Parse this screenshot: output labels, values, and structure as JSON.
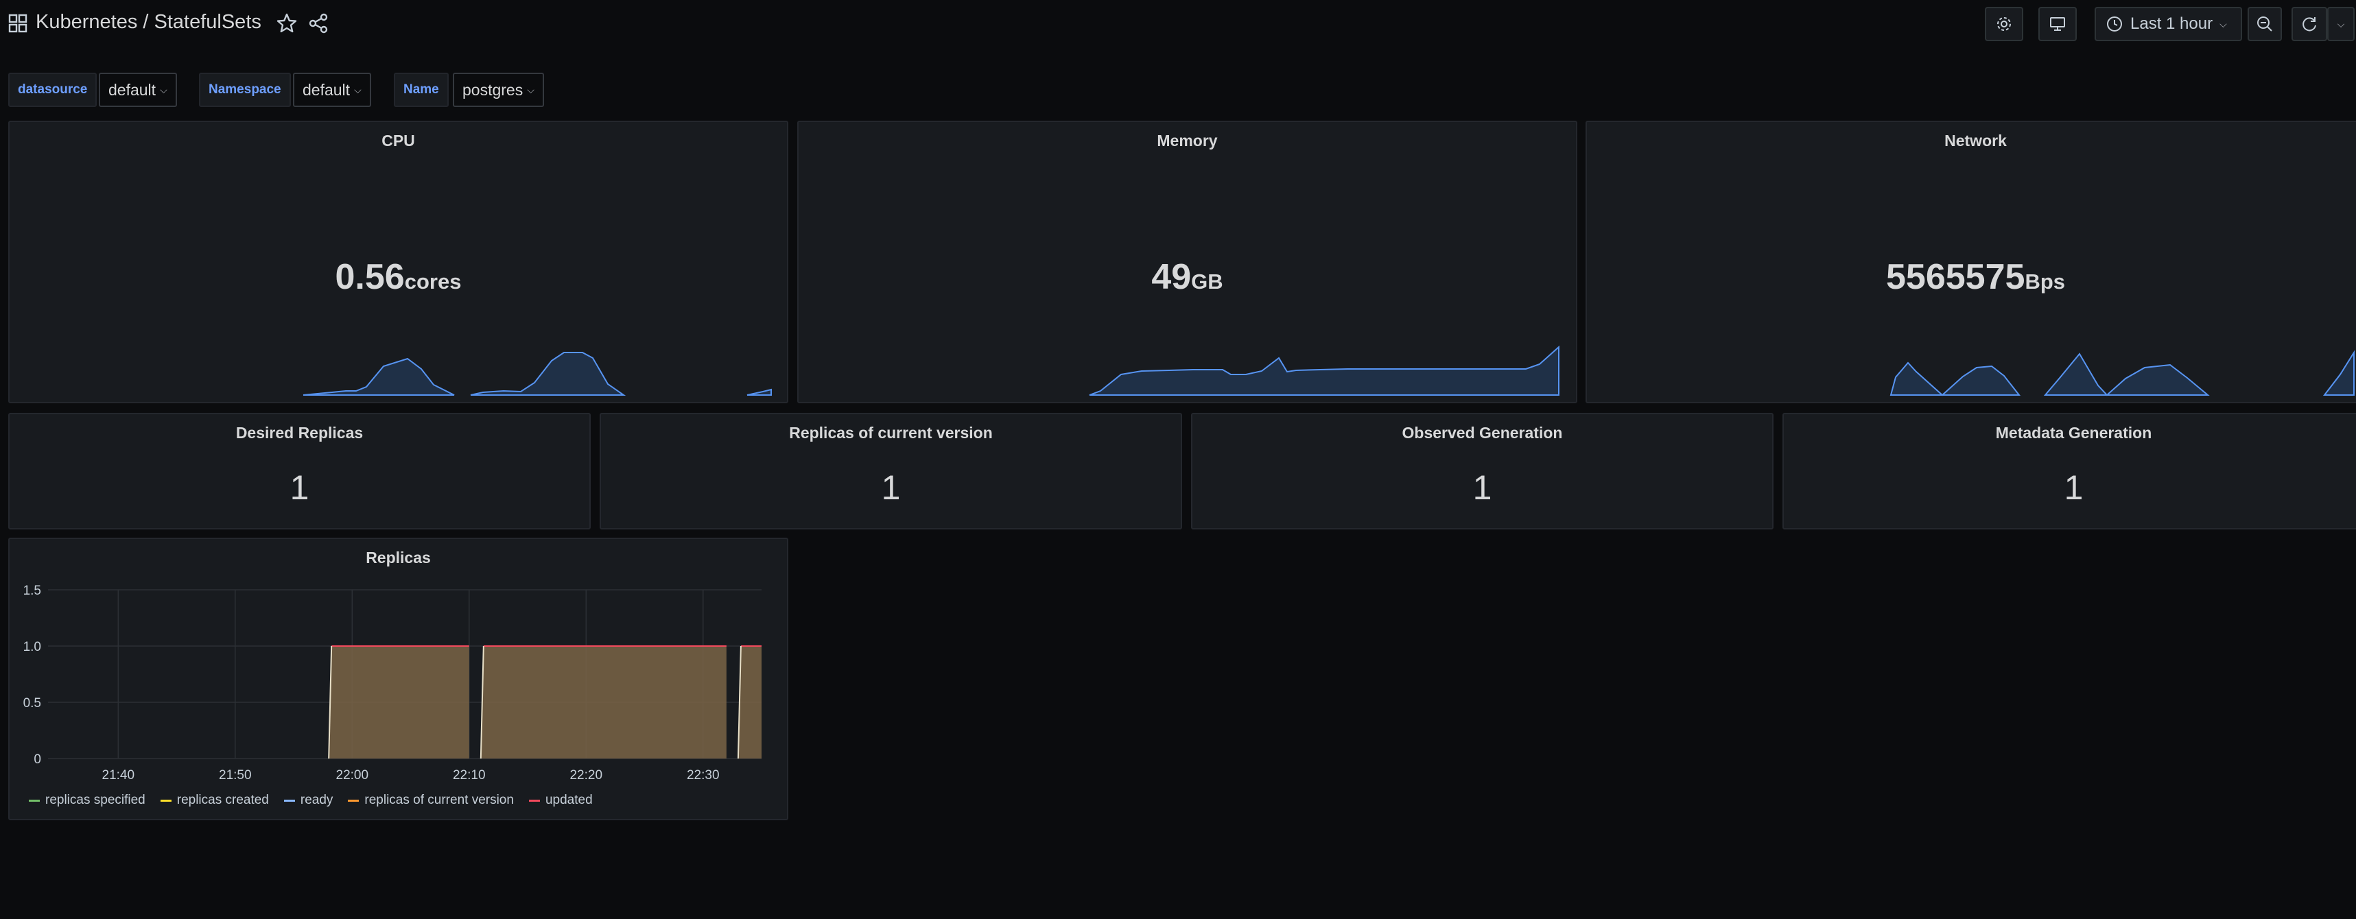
{
  "header": {
    "title": "Kubernetes / StatefulSets",
    "time_range": "Last 1 hour"
  },
  "variables": [
    {
      "label": "datasource",
      "value": "default"
    },
    {
      "label": "Namespace",
      "value": "default"
    },
    {
      "label": "Name",
      "value": "postgres"
    }
  ],
  "stats": {
    "cpu": {
      "title": "CPU",
      "value": "0.56",
      "unit": "cores"
    },
    "memory": {
      "title": "Memory",
      "value": "49",
      "unit": "GB"
    },
    "network": {
      "title": "Network",
      "value": "5565575",
      "unit": "Bps"
    }
  },
  "replica_stats": [
    {
      "title": "Desired Replicas",
      "value": "1"
    },
    {
      "title": "Replicas of current version",
      "value": "1"
    },
    {
      "title": "Observed Generation",
      "value": "1"
    },
    {
      "title": "Metadata Generation",
      "value": "1"
    }
  ],
  "colors": {
    "spark_line": "#5794f2",
    "spark_fill": "#1f3047",
    "replicas_fill": "#7a6446",
    "grid": "#2c3035"
  },
  "chart_data": {
    "type": "area",
    "title": "Replicas",
    "x": [
      "21:40",
      "21:50",
      "22:00",
      "22:10",
      "22:20",
      "22:30"
    ],
    "y_ticks": [
      "0",
      "0.5",
      "1.0",
      "1.5"
    ],
    "ylim": [
      0,
      1.5
    ],
    "grid": true,
    "legend_position": "bottom",
    "series": [
      {
        "name": "replicas specified",
        "color": "#73bf69"
      },
      {
        "name": "replicas created",
        "color": "#fade2a"
      },
      {
        "name": "ready",
        "color": "#8ab8ff"
      },
      {
        "name": "replicas of current version",
        "color": "#ff9830"
      },
      {
        "name": "updated",
        "color": "#f2495c"
      }
    ],
    "segments": [
      {
        "start": "21:58",
        "end": "22:10",
        "value": 1
      },
      {
        "start": "22:11",
        "end": "22:32",
        "value": 1
      },
      {
        "start": "22:33",
        "end": "22:35",
        "value": 1
      }
    ]
  }
}
